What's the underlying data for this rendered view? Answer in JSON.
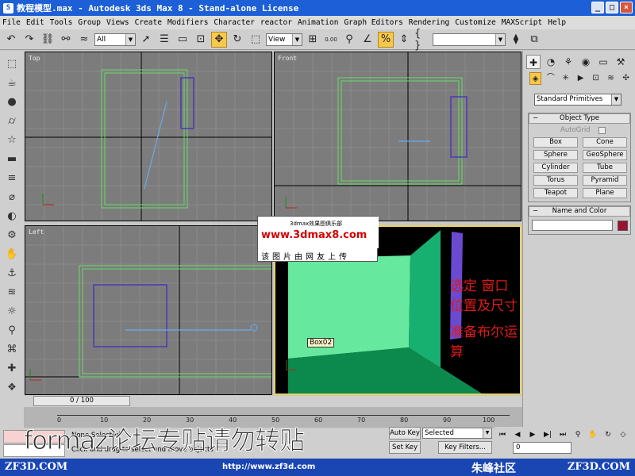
{
  "window": {
    "title": "教程模型.max - Autodesk 3ds Max 8 - Stand-alone License",
    "minimize": "_",
    "maximize": "□",
    "close": "×"
  },
  "menu": [
    "File",
    "Edit",
    "Tools",
    "Group",
    "Views",
    "Create",
    "Modifiers",
    "Character",
    "reactor",
    "Animation",
    "Graph Editors",
    "Rendering",
    "Customize",
    "MAXScript",
    "Help"
  ],
  "toolbar": {
    "selection_filter": "All",
    "ref_coord": "View",
    "angle_snap": "0.00"
  },
  "viewports": {
    "top_label": "Top",
    "front_label": "Front",
    "left_label": "Left",
    "persp_object_label": "Box02"
  },
  "overlay": {
    "line1": "选定 窗口位置及尺寸",
    "line2": "准备布尔运算"
  },
  "watermark": {
    "small": "3dmax效果图俱乐部",
    "url": "www.3dmax8.com",
    "caption": "该图片由网友上传",
    "big": "formaz论坛专贴请勿转贴"
  },
  "command_panel": {
    "category": "Standard Primitives",
    "object_type_title": "Object Type",
    "autogrid_label": "AutoGrid",
    "primitives": [
      "Box",
      "Cone",
      "Sphere",
      "GeoSphere",
      "Cylinder",
      "Tube",
      "Torus",
      "Pyramid",
      "Teapot",
      "Plane"
    ],
    "name_color_title": "Name and Color",
    "object_color": "#9a1232"
  },
  "timeline": {
    "slider": "0 / 100",
    "ticks": [
      "0",
      "10",
      "20",
      "30",
      "40",
      "50",
      "60",
      "70",
      "80",
      "90",
      "100"
    ]
  },
  "status": {
    "selection": "None Selected",
    "prompt": "Click and drag to select and move objects"
  },
  "keys": {
    "auto_key": "Auto Key",
    "set_key": "Set Key",
    "key_mode": "Selected",
    "key_filters": "Key Filters..."
  },
  "playback": {
    "frame": "0"
  },
  "footer": {
    "left": "ZF3D.COM",
    "url": "http://www.zf3d.com",
    "community": "朱峰社区",
    "right": "ZF3D.COM"
  }
}
